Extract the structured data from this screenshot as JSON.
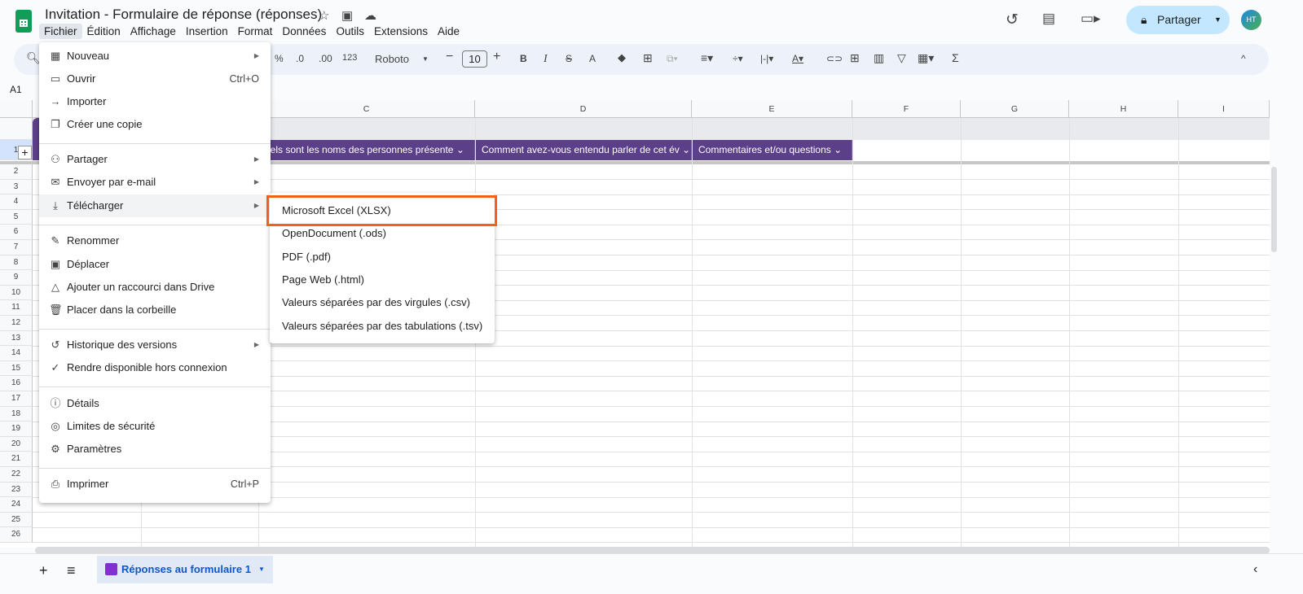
{
  "app": {
    "title": "Invitation - Formulaire de réponse (réponses)",
    "name_box": "A1"
  },
  "menubar": [
    "Fichier",
    "Édition",
    "Affichage",
    "Insertion",
    "Format",
    "Données",
    "Outils",
    "Extensions",
    "Aide"
  ],
  "toolbar": {
    "percent": "%",
    "dec_less": ".0",
    "dec_more": ".00",
    "format_123": "123",
    "font": "Roboto",
    "font_size": "10",
    "bold": "B",
    "italic": "I",
    "strike": "S",
    "text_color": "A",
    "sum": "Σ"
  },
  "share": {
    "label": "Partager"
  },
  "avatar": "HT",
  "columns": [
    "A",
    "B",
    "C",
    "D",
    "E",
    "F",
    "G",
    "H",
    "I"
  ],
  "header_row": [
    "uels sont les noms des personnes présente",
    "Comment avez-vous entendu parler de cet év",
    "Commentaires et/ou questions"
  ],
  "row_numbers": [
    "1",
    "2",
    "3",
    "4",
    "5",
    "6",
    "7",
    "8",
    "9",
    "10",
    "11",
    "12",
    "13",
    "14",
    "15",
    "16",
    "17",
    "18",
    "19",
    "20",
    "21",
    "22",
    "23",
    "24",
    "25",
    "26"
  ],
  "file_menu": [
    {
      "label": "Nouveau",
      "icon": "new-sheet-icon",
      "submenu": true
    },
    {
      "label": "Ouvrir",
      "icon": "folder-icon",
      "shortcut": "Ctrl+O"
    },
    {
      "label": "Importer",
      "icon": "import-icon"
    },
    {
      "label": "Créer une copie",
      "icon": "copy-icon"
    },
    {
      "label": "Partager",
      "icon": "person-add-icon",
      "submenu": true
    },
    {
      "label": "Envoyer par e-mail",
      "icon": "mail-icon",
      "submenu": true
    },
    {
      "label": "Télécharger",
      "icon": "download-icon",
      "submenu": true
    },
    {
      "label": "Renommer",
      "icon": "pencil-icon"
    },
    {
      "label": "Déplacer",
      "icon": "move-folder-icon"
    },
    {
      "label": "Ajouter un raccourci dans Drive",
      "icon": "drive-shortcut-icon"
    },
    {
      "label": "Placer dans la corbeille",
      "icon": "trash-icon"
    },
    {
      "label": "Historique des versions",
      "icon": "history-icon",
      "submenu": true
    },
    {
      "label": "Rendre disponible hors connexion",
      "icon": "offline-icon"
    },
    {
      "label": "Détails",
      "icon": "info-icon"
    },
    {
      "label": "Limites de sécurité",
      "icon": "security-icon"
    },
    {
      "label": "Paramètres",
      "icon": "gear-icon"
    },
    {
      "label": "Imprimer",
      "icon": "printer-icon",
      "shortcut": "Ctrl+P"
    }
  ],
  "download_submenu": [
    "Microsoft Excel (XLSX)",
    "OpenDocument (.ods)",
    "PDF (.pdf)",
    "Page Web (.html)",
    "Valeurs séparées par des virgules (.csv)",
    "Valeurs séparées par des tabulations (.tsv)"
  ],
  "sheet_tab": {
    "label": "Réponses au formulaire 1"
  },
  "colors": {
    "header_purple": "#5b3f88",
    "highlight": "#f4601c",
    "share_bg": "#c2e7ff"
  }
}
